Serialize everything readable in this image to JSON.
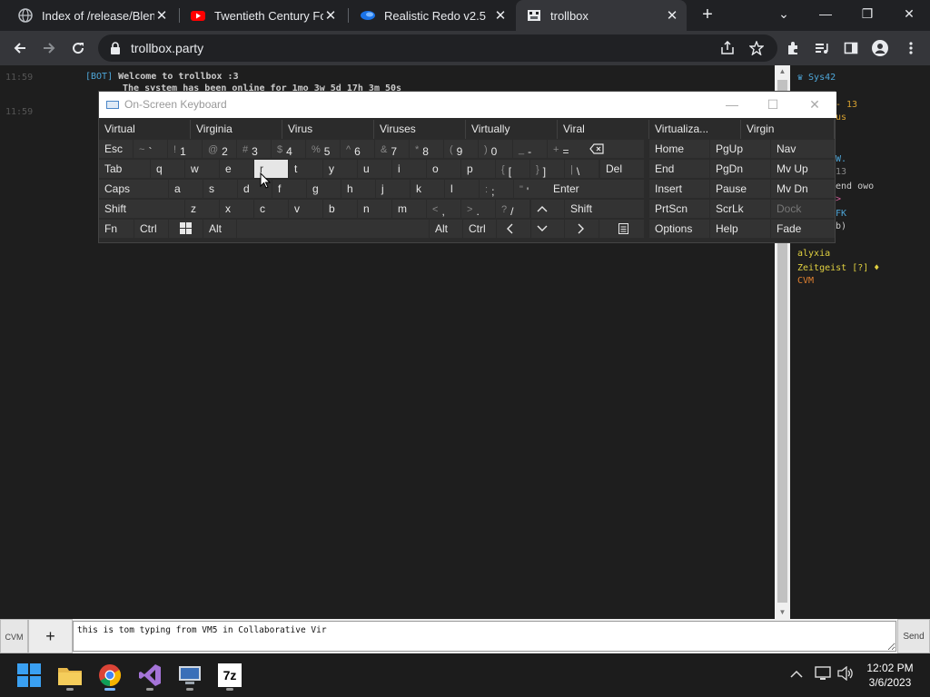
{
  "browser": {
    "tabs": [
      {
        "title": "Index of /release/Blend",
        "icon": "globe-icon",
        "active": false
      },
      {
        "title": "Twentieth Century Fox",
        "icon": "youtube-icon",
        "active": false
      },
      {
        "title": "Realistic Redo v2.5",
        "icon": "site-icon",
        "active": false
      },
      {
        "title": "trollbox",
        "icon": "trollbox-icon",
        "active": true
      }
    ],
    "new_tab": "+",
    "window_controls": {
      "dropdown": "⌄",
      "minimize": "—",
      "maximize": "❐",
      "close": "✕"
    },
    "url": "trollbox.party",
    "close_glyph": "✕"
  },
  "chat": {
    "messages": [
      {
        "time": "11:59",
        "nick": "[BOT]",
        "text": "Welcome to trollbox :3"
      },
      {
        "time": "",
        "nick": "",
        "text": "The system has been online for 1mo 3w 5d 17h 3m 50s"
      },
      {
        "time": "11:59",
        "nick": "",
        "text": ""
      }
    ]
  },
  "userlist": [
    {
      "name": "♛ Sys42",
      "color": "#4ea6d8"
    },
    {
      "name": "- 13",
      "color": "#d6a030"
    },
    {
      "name": "us",
      "color": "#d6a030"
    },
    {
      "name": "W.",
      "color": "#4ea6d8"
    },
    {
      "name": "13",
      "color": "#888888"
    },
    {
      "name": "end owo",
      "color": "#cccccc"
    },
    {
      "name": ">",
      "color": "#d45f9a"
    },
    {
      "name": "FK",
      "color": "#4ea6d8"
    },
    {
      "name": "b)",
      "color": "#cccccc"
    },
    {
      "name": "Sunner",
      "color": "#d6a030"
    },
    {
      "name": "alyxia",
      "color": "#e0d040"
    },
    {
      "name": "Zeitgeist [?] ♦",
      "color": "#e0d040"
    },
    {
      "name": "CVM",
      "color": "#e08030"
    }
  ],
  "osk": {
    "title": "On-Screen Keyboard",
    "controls": {
      "minimize": "—",
      "maximize": "☐",
      "close": "✕"
    },
    "predictions": [
      "Virtual",
      "Virginia",
      "Virus",
      "Viruses",
      "Virtually",
      "Viral",
      "Virtualiza...",
      "Virgin"
    ],
    "keys": {
      "esc": "Esc",
      "tab": "Tab",
      "caps": "Caps",
      "shift": "Shift",
      "fn": "Fn",
      "ctrl": "Ctrl",
      "alt": "Alt",
      "del": "Del",
      "enter": "Enter",
      "home": "Home",
      "pgup": "PgUp",
      "nav": "Nav",
      "end": "End",
      "pgdn": "PgDn",
      "mvup": "Mv Up",
      "insert": "Insert",
      "pause": "Pause",
      "mvdn": "Mv Dn",
      "prtscn": "PrtScn",
      "scrlk": "ScrLk",
      "dock": "Dock",
      "options": "Options",
      "help": "Help",
      "fade": "Fade"
    },
    "row1": [
      [
        "~",
        "`"
      ],
      [
        "!",
        "1"
      ],
      [
        "@",
        "2"
      ],
      [
        "#",
        "3"
      ],
      [
        "$",
        "4"
      ],
      [
        "%",
        "5"
      ],
      [
        "^",
        "6"
      ],
      [
        "&",
        "7"
      ],
      [
        "*",
        "8"
      ],
      [
        "(",
        "9"
      ],
      [
        ")",
        "0"
      ],
      [
        "_",
        "-"
      ],
      [
        "+",
        "="
      ]
    ],
    "row2": [
      "q",
      "w",
      "e",
      "r",
      "t",
      "y",
      "u",
      "i",
      "o",
      "p"
    ],
    "row2_sym": [
      [
        "{",
        "["
      ],
      [
        "}",
        "]"
      ],
      [
        "|",
        "\\"
      ]
    ],
    "row3": [
      "a",
      "s",
      "d",
      "f",
      "g",
      "h",
      "j",
      "k",
      "l"
    ],
    "row3_sym": [
      [
        ":",
        ";"
      ],
      [
        "\"",
        "'"
      ]
    ],
    "row4": [
      "z",
      "x",
      "c",
      "v",
      "b",
      "n",
      "m"
    ],
    "row4_sym": [
      [
        "<",
        ","
      ],
      [
        ">",
        "."
      ],
      [
        "?",
        "/"
      ]
    ],
    "pressed_key": "r"
  },
  "input": {
    "cvm_label": "CVM",
    "plus_label": "+",
    "value": "this is tom typing from VM5 in Collaborative Vir",
    "send_label": "Send"
  },
  "taskbar": {
    "apps": [
      "windows-start-icon",
      "file-explorer-icon",
      "chrome-icon",
      "visual-studio-icon",
      "remote-desktop-icon",
      "7zip-icon"
    ],
    "seven_zip_label": "7z",
    "time": "12:02 PM",
    "date": "3/6/2023"
  }
}
